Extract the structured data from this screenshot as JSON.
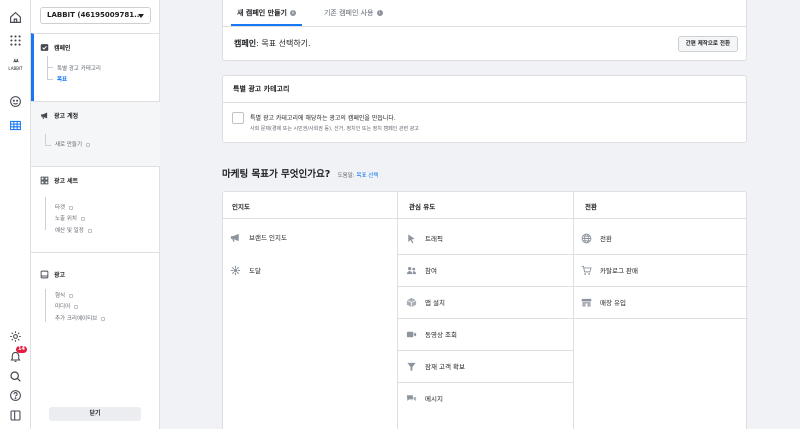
{
  "rail": {
    "logo_text": "LABBIT",
    "badge": "14"
  },
  "nav": {
    "account": "LABBIT (46195009781...",
    "campaign": {
      "title": "캠페인",
      "items": [
        "특별 광고 카테고리",
        "목표"
      ]
    },
    "adset_account": {
      "title": "광고 계정",
      "items": [
        "새로 만들기"
      ]
    },
    "adset": {
      "title": "광고 세트",
      "items": [
        "타겟",
        "노출 위치",
        "예산 및 일정"
      ]
    },
    "ad": {
      "title": "광고",
      "items": [
        "형식",
        "미디어",
        "추가 크리에이티브"
      ]
    },
    "close": "닫기"
  },
  "tabs": [
    "새 캠페인 만들기",
    "기존 캠페인 사용"
  ],
  "campaign_line": {
    "label": "캠페인",
    "value": ": 목표 선택하기."
  },
  "quick_button": "간편 제작으로 전환",
  "special": {
    "title": "특별 광고 카테고리",
    "main": "특별 광고 카테고리에 해당하는 광고의 캠페인을 만듭니다.",
    "sub": "사회 문제(경제 또는 시민권/사회권 등), 선거, 정치인 또는 정치 캠페인 관련 광고"
  },
  "objective": {
    "heading": "마케팅 목표가 무엇인가요?",
    "help_prefix": "도움말:",
    "help_link": "목표 선택",
    "columns": [
      {
        "title": "인지도",
        "items": [
          {
            "label": "브랜드 인지도",
            "icon": "megaphone-icon"
          },
          {
            "label": "도달",
            "icon": "reach-icon"
          }
        ]
      },
      {
        "title": "관심 유도",
        "items": [
          {
            "label": "트래픽",
            "icon": "cursor-icon"
          },
          {
            "label": "참여",
            "icon": "people-icon"
          },
          {
            "label": "앱 설치",
            "icon": "box-icon"
          },
          {
            "label": "동영상 조회",
            "icon": "video-icon"
          },
          {
            "label": "잠재 고객 확보",
            "icon": "funnel-icon"
          },
          {
            "label": "메시지",
            "icon": "chat-icon"
          }
        ]
      },
      {
        "title": "전환",
        "items": [
          {
            "label": "전환",
            "icon": "globe-icon"
          },
          {
            "label": "카탈로그 판매",
            "icon": "cart-icon"
          },
          {
            "label": "매장 유입",
            "icon": "store-icon"
          }
        ]
      }
    ]
  }
}
